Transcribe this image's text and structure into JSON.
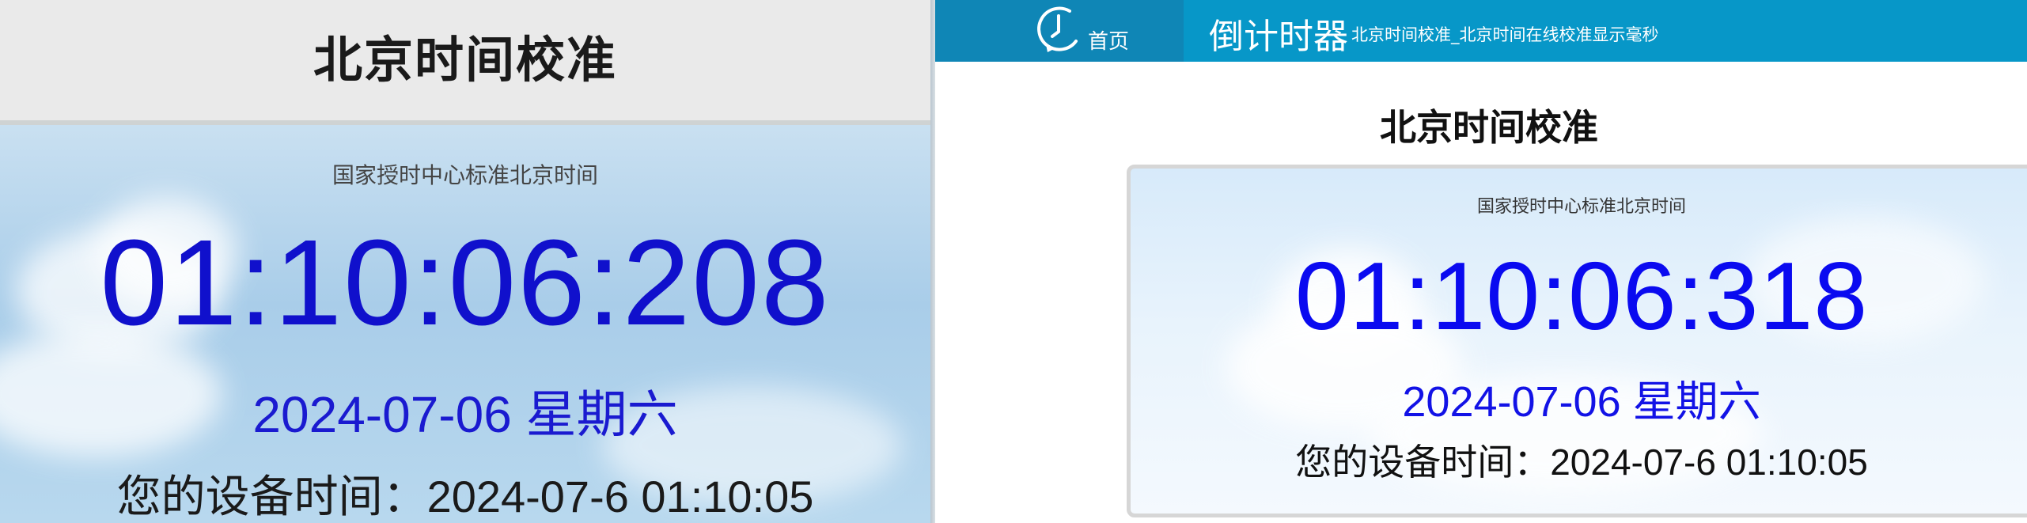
{
  "left_panel": {
    "title": "北京时间校准",
    "subtitle": "国家授时中心标准北京时间",
    "clock": "01:10:06:208",
    "date": "2024-07-06 星期六",
    "device_time": "您的设备时间：2024-07-6 01:10:05"
  },
  "right_panel": {
    "nav": {
      "home_label": "首页",
      "home_icon": "clock-icon",
      "title": "倒计时器",
      "subtitle": "北京时间校准_北京时间在线校准显示毫秒"
    },
    "heading": "北京时间校准",
    "subtitle": "国家授时中心标准北京时间",
    "clock": "01:10:06:318",
    "date": "2024-07-06 星期六",
    "device_time": "您的设备时间：2024-07-6 01:10:05"
  },
  "colors": {
    "nav_bg": "#0797c8",
    "home_bg": "#0f86b6",
    "clock_blue": "#0a0af0",
    "sky_light": "#d7eafa"
  }
}
